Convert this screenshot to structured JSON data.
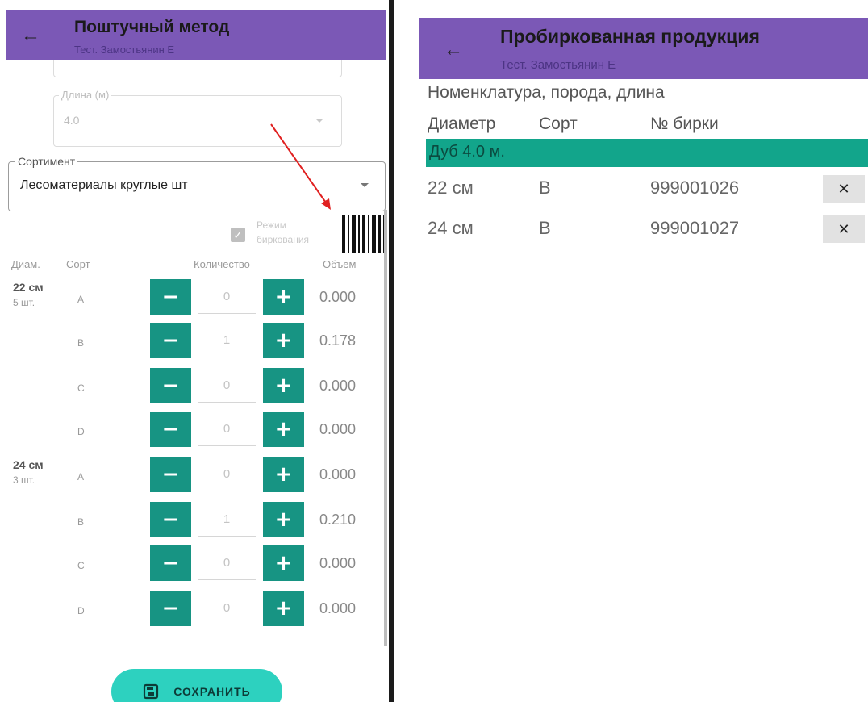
{
  "left": {
    "appbar": {
      "title": "Поштучный метод",
      "subtitle": "Тест. Замостьянин Е"
    },
    "length_field": {
      "label": "Длина (м)",
      "value": "4.0"
    },
    "assortment_field": {
      "label": "Сортимент",
      "value": "Лесоматериалы круглые шт"
    },
    "tagging_mode": {
      "label_line1": "Режим",
      "label_line2": "биркования",
      "checked": true
    },
    "table_headers": {
      "diam": "Диам.",
      "grade": "Сорт",
      "quantity": "Количество",
      "volume": "Объем"
    },
    "groups": [
      {
        "diameter": "22 см",
        "count": "5 шт.",
        "rows": [
          {
            "grade": "A",
            "qty": "0",
            "volume": "0.000"
          },
          {
            "grade": "B",
            "qty": "1",
            "volume": "0.178"
          },
          {
            "grade": "C",
            "qty": "0",
            "volume": "0.000"
          },
          {
            "grade": "D",
            "qty": "0",
            "volume": "0.000"
          }
        ]
      },
      {
        "diameter": "24 см",
        "count": "3 шт.",
        "rows": [
          {
            "grade": "A",
            "qty": "0",
            "volume": "0.000"
          },
          {
            "grade": "B",
            "qty": "1",
            "volume": "0.210"
          },
          {
            "grade": "C",
            "qty": "0",
            "volume": "0.000"
          },
          {
            "grade": "D",
            "qty": "0",
            "volume": "0.000"
          }
        ]
      }
    ],
    "minus_symbol": "−",
    "plus_symbol": "+",
    "save_label": "СОХРАНИТЬ"
  },
  "right": {
    "appbar": {
      "title": "Пробиркованная продукция",
      "subtitle": "Тест. Замостьянин Е"
    },
    "header_line1": "Номенклатура, порода, длина",
    "headers": {
      "diameter": "Диаметр",
      "grade": "Сорт",
      "tag": "№ бирки"
    },
    "group_title": "Дуб 4.0 м.",
    "rows": [
      {
        "diameter": "22 см",
        "grade": "B",
        "tag": "999001026"
      },
      {
        "diameter": "24 см",
        "grade": "B",
        "tag": "999001027"
      }
    ],
    "delete_symbol": "✕"
  },
  "back_symbol": "←",
  "colors": {
    "appbar": "#7b58b6",
    "accent": "#179483",
    "save_button": "#2dd1bf",
    "group_bar": "#12a58b",
    "annotation_arrow": "#e02020"
  }
}
